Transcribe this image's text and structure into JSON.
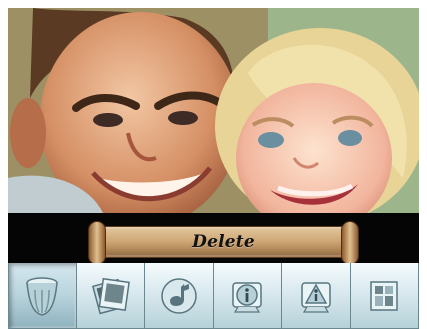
{
  "screen": {
    "photo_subject": "father-and-child-photo"
  },
  "label": {
    "text": "Delete"
  },
  "toolbar": {
    "selected_index": 0,
    "buttons": [
      {
        "icon": "trash-can-icon",
        "state": "selected"
      },
      {
        "icon": "film-slides-icon",
        "state": "normal"
      },
      {
        "icon": "music-note-icon",
        "state": "normal"
      },
      {
        "icon": "info-icon",
        "state": "normal"
      },
      {
        "icon": "alert-info-icon",
        "state": "normal"
      },
      {
        "icon": "layout-grid-icon",
        "state": "normal"
      }
    ]
  },
  "colors": {
    "background": "#000000",
    "toolbar_blue": "#cfe1e7",
    "plaque_brown": "#cfa977",
    "text": "#121212"
  }
}
